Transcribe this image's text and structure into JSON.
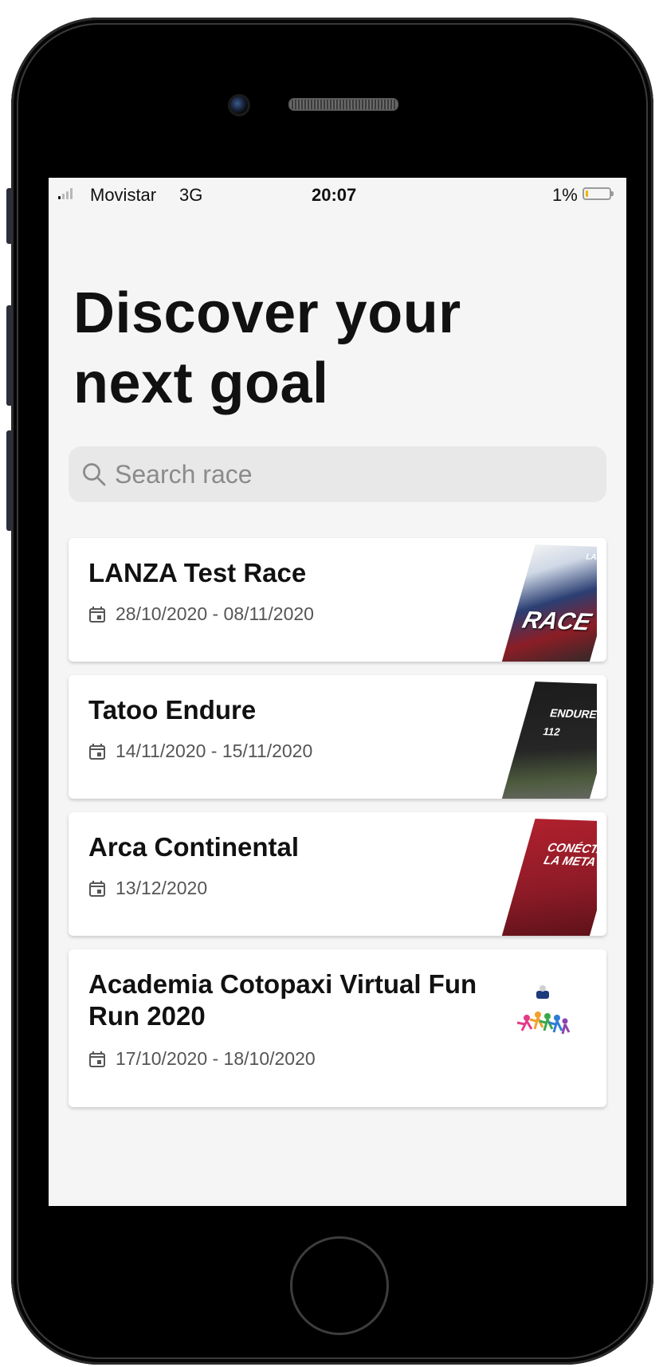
{
  "status_bar": {
    "carrier": "Movistar",
    "network": "3G",
    "time": "20:07",
    "battery": "1%",
    "battery_level": 0.01
  },
  "header": {
    "title_line1": "Discover your",
    "title_line2": "next goal"
  },
  "search": {
    "placeholder": "Search race",
    "value": ""
  },
  "races": [
    {
      "name": "LANZA Test Race",
      "dates": "28/10/2020 - 08/11/2020",
      "poster_text": "RACE",
      "poster_brand": "LANZA"
    },
    {
      "name": "Tatoo Endure",
      "dates": "14/11/2020 - 15/11/2020",
      "poster_text": "ENDURE",
      "poster_number": "112"
    },
    {
      "name": "Arca Continental",
      "dates": "13/12/2020",
      "poster_text": "CONÉCTATE LA META"
    },
    {
      "name": "Academia Cotopaxi Virtual Fun Run 2020",
      "dates": "17/10/2020 - 18/10/2020"
    }
  ],
  "colors": {
    "screen_bg": "#f5f5f5",
    "card_bg": "#ffffff",
    "search_bg": "#e8e8e8",
    "title_text": "#111111",
    "date_text": "#555555",
    "placeholder_text": "#8b8b8b"
  },
  "icons": {
    "search": "search-icon",
    "calendar": "calendar-icon",
    "signal": "signal-icon",
    "battery": "battery-icon"
  }
}
